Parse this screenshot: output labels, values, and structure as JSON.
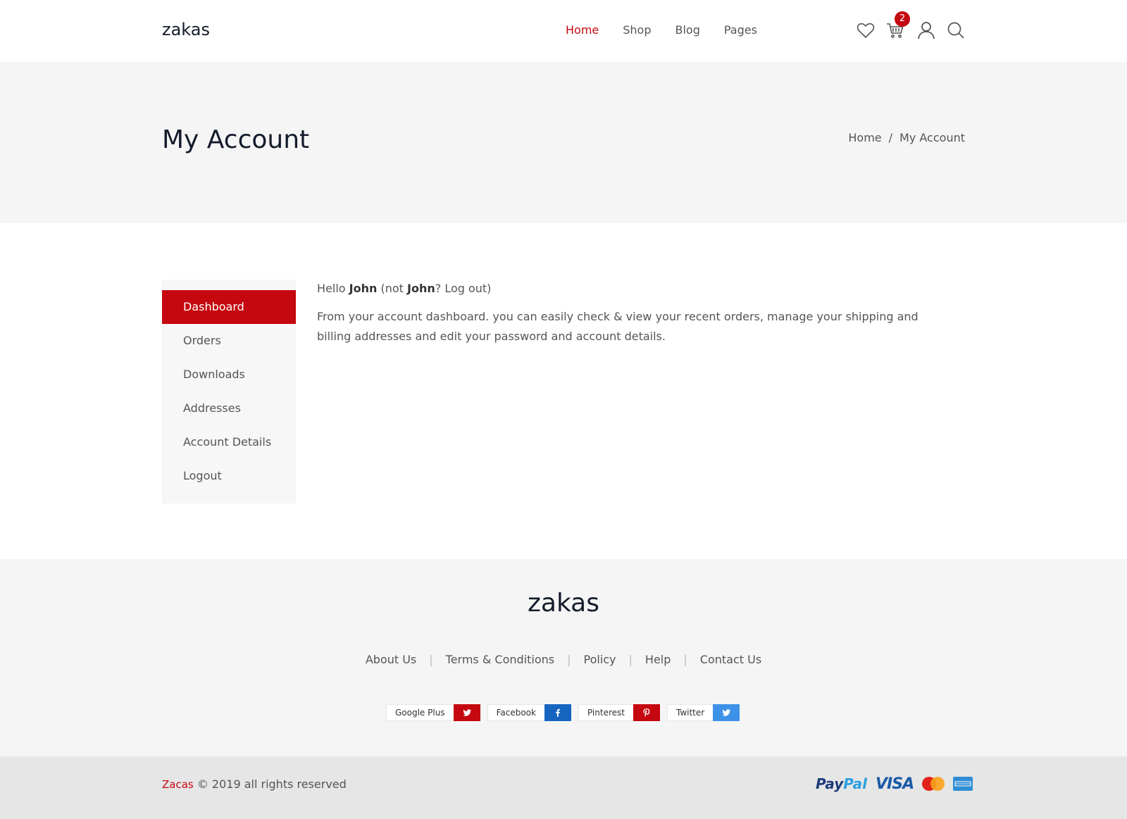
{
  "header": {
    "logo": "zakas",
    "nav": [
      {
        "label": "Home",
        "active": true
      },
      {
        "label": "Shop",
        "active": false
      },
      {
        "label": "Blog",
        "active": false
      },
      {
        "label": "Pages",
        "active": false
      }
    ],
    "icons": [
      "heart-icon",
      "cart-icon",
      "user-icon",
      "search-icon"
    ],
    "cart_count": "2"
  },
  "title_band": {
    "title": "My Account",
    "breadcrumb": {
      "home": "Home",
      "separator": "/",
      "current": "My Account"
    }
  },
  "account": {
    "menu": [
      {
        "label": "Dashboard",
        "active": true
      },
      {
        "label": "Orders",
        "active": false
      },
      {
        "label": "Downloads",
        "active": false
      },
      {
        "label": "Addresses",
        "active": false
      },
      {
        "label": "Account Details",
        "active": false
      },
      {
        "label": "Logout",
        "active": false
      }
    ],
    "hello_prefix": "Hello ",
    "user_name": "John",
    "hello_mid": " (not ",
    "user_name_2": "John",
    "hello_suffix": "? Log out)",
    "description": "From your account dashboard. you can easily check & view your recent orders, manage your shipping and billing addresses and edit your password and account details."
  },
  "footer": {
    "logo": "zakas",
    "links": [
      "About Us",
      "Terms & Conditions",
      "Policy",
      "Help",
      "Contact Us"
    ],
    "link_separator": "|",
    "social": [
      {
        "label": "Google Plus",
        "icon": "twitter-bird-icon",
        "color": "#c5070f"
      },
      {
        "label": "Facebook",
        "icon": "facebook-icon",
        "color": "#1565c0"
      },
      {
        "label": "Pinterest",
        "icon": "pinterest-icon",
        "color": "#c5070f"
      },
      {
        "label": "Twitter",
        "icon": "twitter-bird-icon",
        "color": "#3d92e8"
      }
    ]
  },
  "bottom": {
    "brand": "Zacas",
    "copyright": " © 2019 all rights reserved",
    "payments": {
      "paypal_a": "Pay",
      "paypal_b": "Pal",
      "visa": "VISA"
    }
  },
  "colors": {
    "accent": "#c5070f",
    "title_band_bg": "#f5f5f5",
    "footer_bg": "#f5f5f5",
    "bottom_bar_bg": "#e6e6e6"
  }
}
